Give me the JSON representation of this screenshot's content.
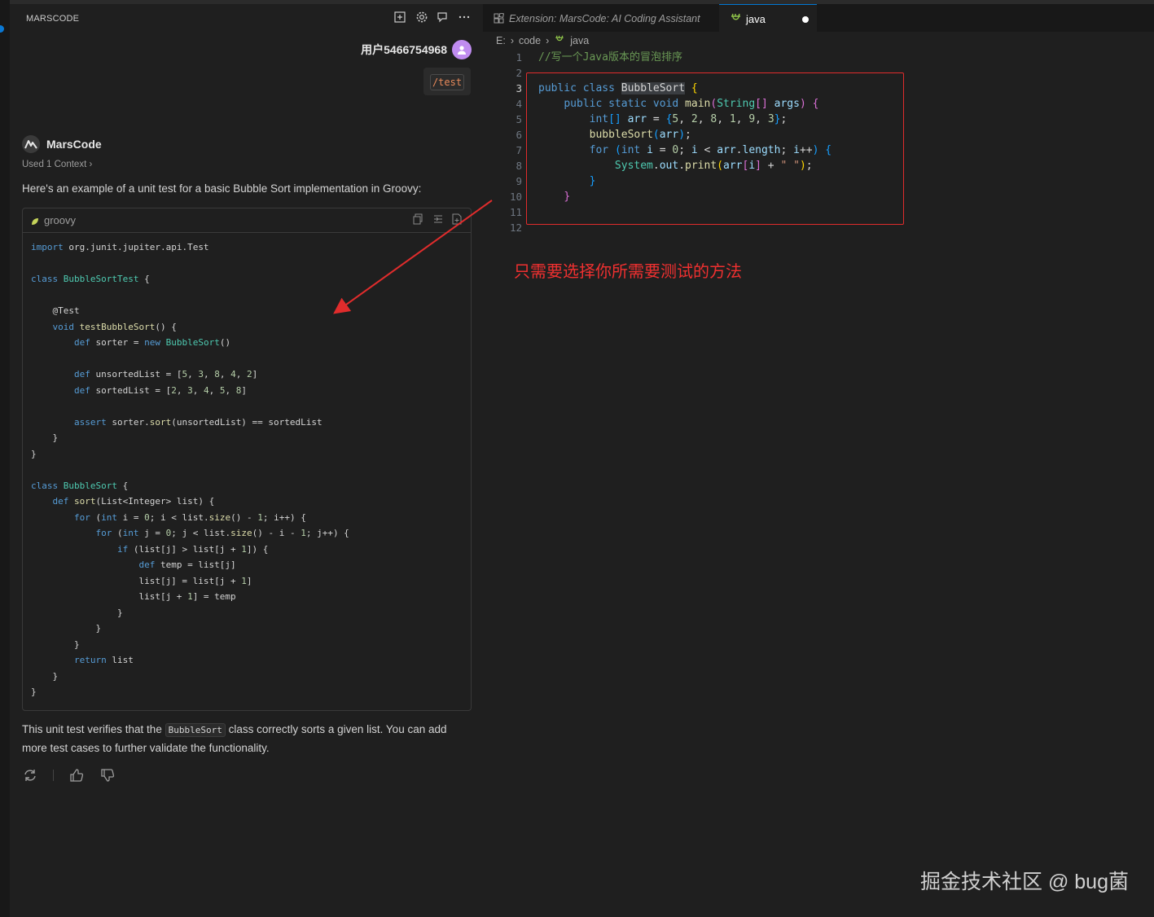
{
  "chat": {
    "title": "MARSCODE",
    "user_name": "用户5466754968",
    "command": "/test",
    "bot_name": "MarsCode",
    "context": "Used 1 Context",
    "intro": "Here's an example of a unit test for a basic Bubble Sort implementation in Groovy:",
    "code_lang": "groovy",
    "summary_before": "This unit test verifies that the",
    "summary_code": "BubbleSort",
    "summary_after": "class correctly sorts a given list. You can add more test cases to further validate the functionality."
  },
  "editor": {
    "tab_inactive": "Extension: MarsCode: AI Coding Assistant",
    "tab_active": "java",
    "breadcrumb": [
      "E:",
      "code",
      "java"
    ],
    "line_numbers": [
      "1",
      "2",
      "3",
      "4",
      "5",
      "6",
      "7",
      "8",
      "9",
      "10",
      "11",
      "12"
    ],
    "current_line": "3",
    "comment": "//写一个Java版本的冒泡排序",
    "annotation": "只需要选择你所需要测试的方法"
  },
  "watermark": "掘金技术社区 @ bug菌",
  "colors": {
    "annotation_red": "#e02c2c",
    "accent": "#0078d4",
    "keyword": "#569cd6"
  }
}
